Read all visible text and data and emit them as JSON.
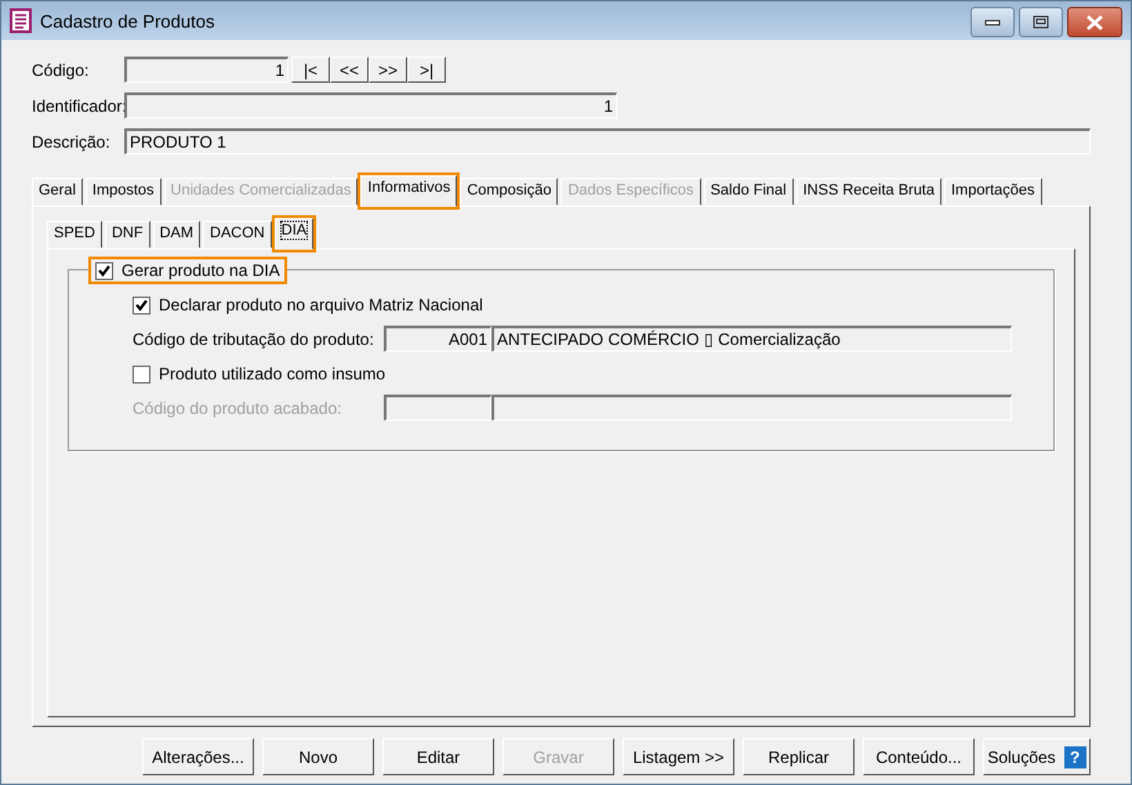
{
  "window": {
    "title": "Cadastro de Produtos"
  },
  "fields": {
    "codigo": {
      "label": "Código:",
      "value": "1"
    },
    "identificador": {
      "label": "Identificador:",
      "value": "1"
    },
    "descricao": {
      "label": "Descrição:",
      "value": "PRODUTO 1"
    }
  },
  "nav_buttons": [
    "|<",
    "<<",
    ">>",
    ">|"
  ],
  "tabs": [
    {
      "label": "Geral",
      "selected": false,
      "disabled": false,
      "highlighted": false
    },
    {
      "label": "Impostos",
      "selected": false,
      "disabled": false,
      "highlighted": false
    },
    {
      "label": "Unidades Comercializadas",
      "selected": false,
      "disabled": true,
      "highlighted": false
    },
    {
      "label": "Informativos",
      "selected": true,
      "disabled": false,
      "highlighted": true
    },
    {
      "label": "Composição",
      "selected": false,
      "disabled": false,
      "highlighted": false
    },
    {
      "label": "Dados Específicos",
      "selected": false,
      "disabled": true,
      "highlighted": false
    },
    {
      "label": "Saldo Final",
      "selected": false,
      "disabled": false,
      "highlighted": false
    },
    {
      "label": "INSS Receita Bruta",
      "selected": false,
      "disabled": false,
      "highlighted": false
    },
    {
      "label": "Importações",
      "selected": false,
      "disabled": false,
      "highlighted": false
    }
  ],
  "subtabs": [
    {
      "label": "SPED",
      "selected": false,
      "highlighted": false
    },
    {
      "label": "DNF",
      "selected": false,
      "highlighted": false
    },
    {
      "label": "DAM",
      "selected": false,
      "highlighted": false
    },
    {
      "label": "DACON",
      "selected": false,
      "highlighted": false
    },
    {
      "label": "DIA",
      "selected": true,
      "highlighted": true
    }
  ],
  "group": {
    "label": "Gerar produto na DIA",
    "checked": true,
    "highlighted": true,
    "declarar": {
      "label": "Declarar produto no arquivo Matriz Nacional",
      "checked": true
    },
    "tributacao": {
      "label": "Código de tributação do produto:",
      "code": "A001",
      "description": "ANTECIPADO COMÉRCIO ▯ Comercialização",
      "disabled": false
    },
    "insumo": {
      "label": "Produto utilizado como insumo",
      "checked": false
    },
    "acabado": {
      "label": "Código do produto acabado:",
      "disabled": true
    }
  },
  "buttons": [
    {
      "label": "Alterações...",
      "disabled": false
    },
    {
      "label": "Novo",
      "disabled": false
    },
    {
      "label": "Editar",
      "disabled": false
    },
    {
      "label": "Gravar",
      "disabled": true
    },
    {
      "label": "Listagem >>",
      "disabled": false
    },
    {
      "label": "Replicar",
      "disabled": false
    },
    {
      "label": "Conteúdo...",
      "disabled": false
    }
  ],
  "help_button": {
    "label": "Soluções",
    "icon": "?"
  }
}
